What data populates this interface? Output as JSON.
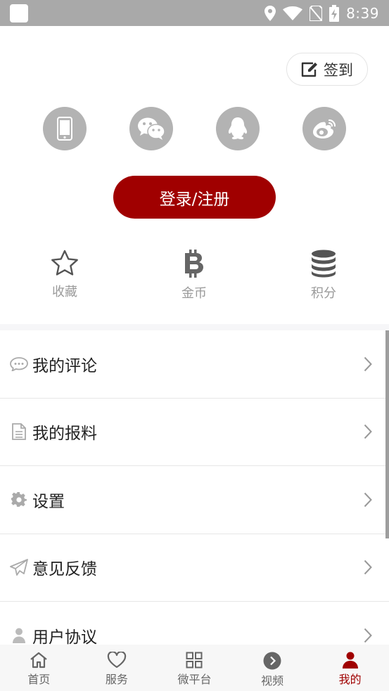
{
  "status_bar": {
    "time": "8:39"
  },
  "header": {
    "checkin_label": "签到"
  },
  "social_login": [
    {
      "name": "phone-icon"
    },
    {
      "name": "wechat-icon"
    },
    {
      "name": "qq-icon"
    },
    {
      "name": "weibo-icon"
    }
  ],
  "login": {
    "label": "登录/注册"
  },
  "stats": [
    {
      "label": "收藏",
      "icon": "star-icon"
    },
    {
      "label": "金币",
      "icon": "bitcoin-icon"
    },
    {
      "label": "积分",
      "icon": "database-icon"
    }
  ],
  "menu": [
    {
      "label": "我的评论",
      "icon": "comment-icon"
    },
    {
      "label": "我的报料",
      "icon": "document-icon"
    },
    {
      "label": "设置",
      "icon": "gear-icon"
    },
    {
      "label": "意见反馈",
      "icon": "paper-plane-icon"
    },
    {
      "label": "用户协议",
      "icon": "user-icon"
    }
  ],
  "bottom_nav": [
    {
      "label": "首页",
      "icon": "home-icon",
      "active": false
    },
    {
      "label": "服务",
      "icon": "heart-icon",
      "active": false
    },
    {
      "label": "微平台",
      "icon": "grid-icon",
      "active": false
    },
    {
      "label": "视频",
      "icon": "play-circle-icon",
      "active": false
    },
    {
      "label": "我的",
      "icon": "person-icon",
      "active": true
    }
  ],
  "colors": {
    "accent": "#a00000",
    "icon_gray": "#b3b3b3",
    "status_bar": "#a9a9a9"
  }
}
